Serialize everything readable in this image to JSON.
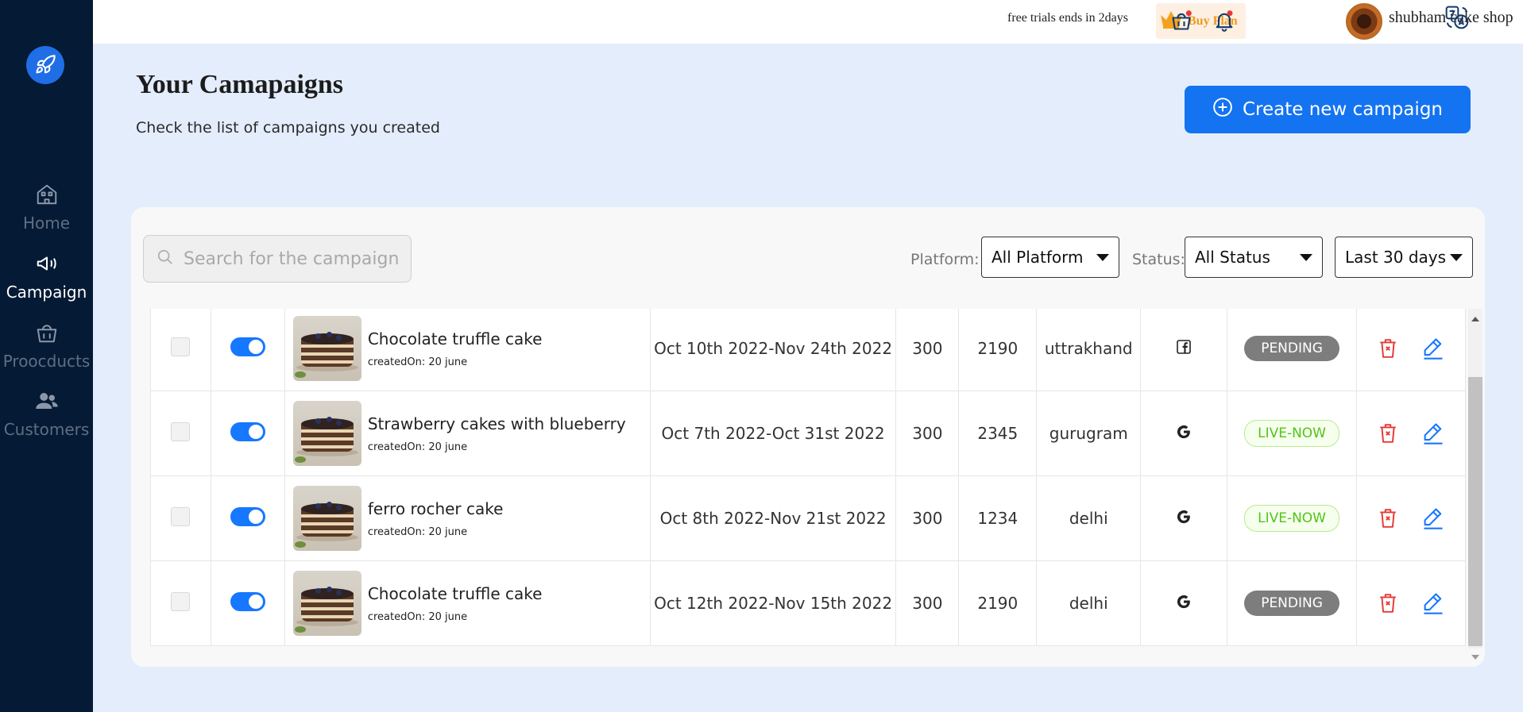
{
  "sidebar": {
    "items": [
      {
        "label": "Home",
        "icon": "home-icon"
      },
      {
        "label": "Campaign",
        "icon": "megaphone-icon"
      },
      {
        "label": "Proocducts",
        "icon": "basket-icon"
      },
      {
        "label": "Customers",
        "icon": "users-icon"
      }
    ]
  },
  "topbar": {
    "trial_text": "free trials ends in 2days",
    "buy_plan": "Buy Plan",
    "shop_name": "shubham cake shop"
  },
  "header": {
    "title": "Your Camapaigns",
    "subtitle": "Check the list of campaigns you created",
    "create_button": "Create new campaign"
  },
  "filters": {
    "search_placeholder": "Search for the campaign",
    "platform_label": "Platform:",
    "platform_value": "All Platform",
    "status_label": "Status:",
    "status_value": "All Status",
    "range_value": "Last 30 days"
  },
  "rows": [
    {
      "name": "Chocolate truffle cake",
      "created": "createdOn: 20 june",
      "dates": "Oct 10th 2022-Nov 24th 2022",
      "budget": "300",
      "reach": "2190",
      "location": "uttrakhand",
      "platform": "facebook",
      "status": "PENDING",
      "status_type": "pending"
    },
    {
      "name": "Strawberry cakes with blueberry",
      "created": "createdOn: 20 june",
      "dates": "Oct 7th 2022-Oct 31st 2022",
      "budget": "300",
      "reach": "2345",
      "location": "gurugram",
      "platform": "google",
      "status": "LIVE-NOW",
      "status_type": "live"
    },
    {
      "name": "ferro rocher cake",
      "created": "createdOn: 20 june",
      "dates": "Oct 8th 2022-Nov 21st 2022",
      "budget": "300",
      "reach": "1234",
      "location": "delhi",
      "platform": "google",
      "status": "LIVE-NOW",
      "status_type": "live"
    },
    {
      "name": "Chocolate truffle cake",
      "created": "createdOn: 20 june",
      "dates": "Oct 12th 2022-Nov 15th 2022",
      "budget": "300",
      "reach": "2190",
      "location": "delhi",
      "platform": "google",
      "status": "PENDING",
      "status_type": "pending"
    }
  ],
  "colors": {
    "sidebar_bg": "#041a35",
    "accent": "#1473f0",
    "page_bg": "#e4edfc",
    "delete": "#e53935",
    "edit": "#1677ff"
  }
}
